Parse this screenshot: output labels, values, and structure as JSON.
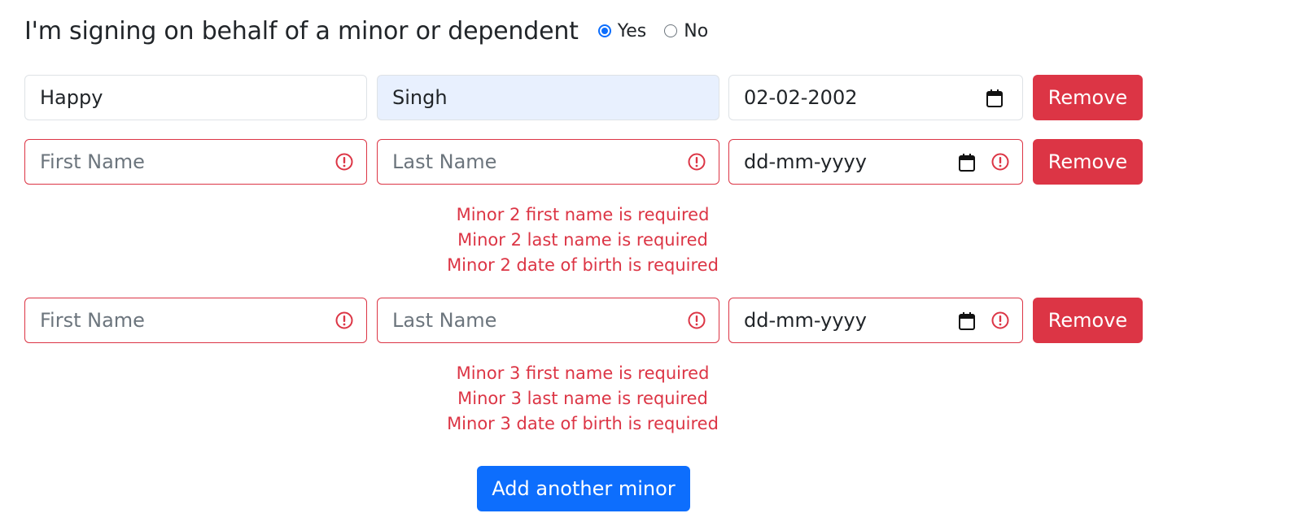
{
  "header": {
    "title": "I'm signing on behalf of a minor or dependent",
    "options": [
      {
        "label": "Yes",
        "checked": true
      },
      {
        "label": "No",
        "checked": false
      }
    ]
  },
  "placeholders": {
    "first_name": "First Name",
    "last_name": "Last Name",
    "dob": "dd-mm-yyyy"
  },
  "minors": [
    {
      "first_name": "Happy",
      "last_name": "Singh",
      "dob": "02-02-2002",
      "remove_label": "Remove",
      "errors": []
    },
    {
      "first_name": "",
      "last_name": "",
      "dob": "",
      "remove_label": "Remove",
      "errors": [
        "Minor 2 first name is required",
        "Minor 2 last name is required",
        "Minor 2 date of birth is required"
      ]
    },
    {
      "first_name": "",
      "last_name": "",
      "dob": "",
      "remove_label": "Remove",
      "errors": [
        "Minor 3 first name is required",
        "Minor 3 last name is required",
        "Minor 3 date of birth is required"
      ]
    }
  ],
  "add_button_label": "Add another minor",
  "colors": {
    "primary": "#0d6efd",
    "danger": "#dc3545",
    "autofill": "#e8f0fe"
  }
}
